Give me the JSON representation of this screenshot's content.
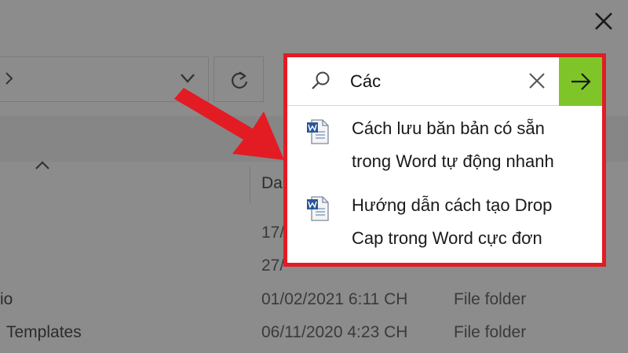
{
  "explorer": {
    "address_chevron_icon": "chevron-right-icon",
    "address_dropdown_icon": "chevron-down-icon",
    "refresh_icon": "refresh-icon",
    "close_icon": "close-icon",
    "sort_icon": "chevron-up-icon",
    "date_column_header": "Da",
    "rows": [
      {
        "name": "",
        "date": "17/",
        "type": ""
      },
      {
        "name": "",
        "date": "27/",
        "type": ""
      },
      {
        "name": "io",
        "date": "01/02/2021 6:11 CH",
        "type": "File folder"
      },
      {
        "name": "Templates",
        "date": "06/11/2020 4:23 CH",
        "type": "File folder"
      }
    ]
  },
  "search": {
    "query": "Các",
    "search_icon": "search-icon",
    "clear_icon": "close-icon",
    "go_icon": "arrow-right-icon",
    "suggestions": [
      {
        "icon": "word-document-icon",
        "line1": "Cách lưu băn bản có sẵn",
        "line2": "trong Word tự động nhanh"
      },
      {
        "icon": "word-document-icon",
        "line1": "Hướng dẫn cách tạo Drop",
        "line2": "Cap trong Word cực đơn"
      }
    ]
  },
  "colors": {
    "highlight_border": "#e31b23",
    "go_button": "#7fc52a",
    "dim_background": "#8c8c8c"
  }
}
